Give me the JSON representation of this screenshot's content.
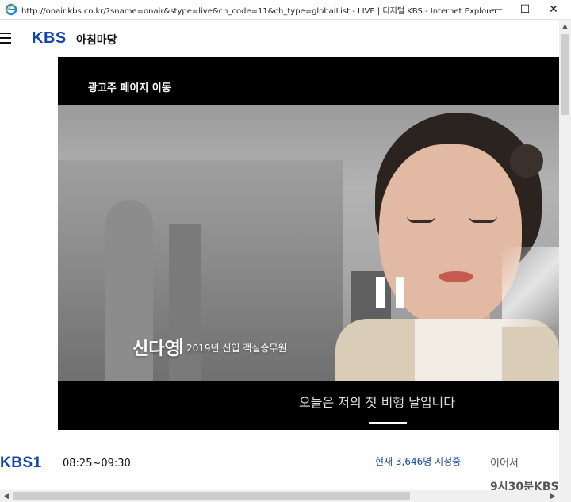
{
  "window": {
    "title": "http://onair.kbs.co.kr/?sname=onair&stype=live&ch_code=11&ch_type=globalList - LIVE | 디지털 KBS - Internet Explorer",
    "min": "—",
    "max": "☐",
    "close": "✕"
  },
  "header": {
    "logo": "KBS",
    "program_title": "아침마당"
  },
  "player": {
    "ad_link": "광고주 페이지 이동",
    "caption_name": "신다영",
    "caption_role": "2019년 신입 객실승무원",
    "subtitle": "오늘은 저의 첫 비행 날입니다"
  },
  "info": {
    "channel_logo": "KBS1",
    "schedule_time": "08:25~09:30",
    "viewer_count": "현재 3,646명 시청중",
    "next_label": "이어서",
    "next_time": "9시30분KBS"
  },
  "colors": {
    "kbs_blue": "#1546a7",
    "player_bg": "#000000"
  },
  "icons": {
    "browser": "ie-icon",
    "menu": "hamburger-menu-icon",
    "pause": "pause-icon"
  }
}
